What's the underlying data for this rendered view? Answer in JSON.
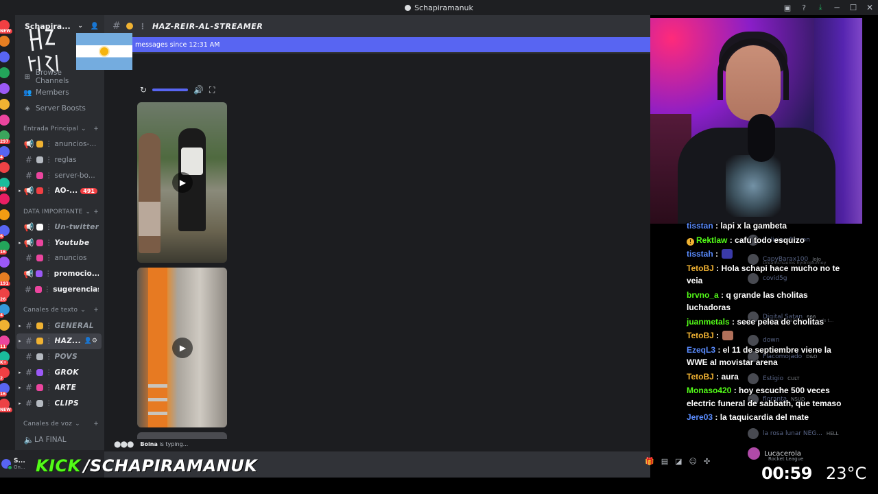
{
  "window": {
    "title": "Schapiramanuk"
  },
  "server": {
    "name": "Schapira..."
  },
  "nav": {
    "browse": "Browse Channels",
    "members": "Members",
    "boosts": "Server Boosts"
  },
  "categories": {
    "entrada": "Entrada Principal",
    "importante": "DATA IMPORTANTE",
    "texto": "Canales de texto",
    "voz": "Canales de voz"
  },
  "channels_entrada": [
    {
      "label": "anuncios-...",
      "emoji_color": "#f0b232"
    },
    {
      "label": "reglas",
      "emoji_color": "#b5bac1"
    },
    {
      "label": "server-bo...",
      "emoji_color": "#eb459e"
    },
    {
      "label": "AO-...",
      "emoji_color": "#f23f43",
      "badge": "491"
    }
  ],
  "channels_importante": [
    {
      "label": "Un-twitter",
      "emoji_color": "#ffffff"
    },
    {
      "label": "Youtube",
      "emoji_color": "#eb459e"
    },
    {
      "label": "anuncios",
      "emoji_color": "#eb459e"
    },
    {
      "label": "promocio...",
      "emoji_color": "#9b59f6"
    },
    {
      "label": "sugerencias",
      "emoji_color": "#eb459e"
    }
  ],
  "channels_texto": [
    {
      "label": "GENERAL",
      "emoji_color": "#f0b232"
    },
    {
      "label": "HAZ...",
      "emoji_color": "#f0b232"
    },
    {
      "label": "POVS",
      "emoji_color": "#b5bac1"
    },
    {
      "label": "GROK",
      "emoji_color": "#9b59f6"
    },
    {
      "label": "ARTE",
      "emoji_color": "#eb459e"
    },
    {
      "label": "CLIPS",
      "emoji_color": "#b5bac1"
    }
  ],
  "channels_voz": [
    {
      "label": "LA FINAL"
    }
  ],
  "rail_badges": [
    "NEW",
    "",
    "",
    "",
    "",
    "",
    "",
    "297",
    "4",
    "",
    "44",
    "",
    "",
    "6",
    "16",
    "",
    "191",
    "26",
    "4",
    "",
    "11",
    "K+",
    "2",
    "16",
    "NEW"
  ],
  "user": {
    "name": "S...",
    "status": "On..."
  },
  "channel": {
    "name": "HAZ-REIR-AL-STREAMER"
  },
  "banner": {
    "text": "messages since 12:31 AM"
  },
  "typing": {
    "user": "Boina",
    "text": " is typing..."
  },
  "kick": {
    "logo": "KICK",
    "handle": "/SCHAPIRAMANUK"
  },
  "chat": [
    {
      "nick": "tisstan",
      "color": "#5a8cff",
      "text": " : lapi x la gambeta"
    },
    {
      "nick": "Rektlaw",
      "color": "#53fc18",
      "text": " : cafu todo esquizo",
      "warn": true
    },
    {
      "nick": "tisstah",
      "color": "#5a8cff",
      "text": " : ",
      "emote": true
    },
    {
      "nick": "TetoBJ",
      "color": "#f0b232",
      "text": " : Hola schapi hace mucho no te veia"
    },
    {
      "nick": "brvno_a",
      "color": "#53fc18",
      "text": " : q grande las cholitas luchadoras"
    },
    {
      "nick": "juanmetals",
      "color": "#53fc18",
      "text": " : seee pelea de cholitas"
    },
    {
      "nick": "TetoBJ",
      "color": "#f0b232",
      "text": " : ",
      "emote": true
    },
    {
      "nick": "EzeqL3",
      "color": "#5a8cff",
      "text": " : el 11 de septiembre viene la WWE al movistar arena"
    },
    {
      "nick": "TetoBJ",
      "color": "#f0b232",
      "text": " : aura"
    },
    {
      "nick": "Monaso420",
      "color": "#53fc18",
      "text": " : hoy escuche 500 veces electric funeral de sabbath, que temaso"
    },
    {
      "nick": "Jere03",
      "color": "#5a8cff",
      "text": " : la taquicardia del mate"
    }
  ],
  "members": [
    {
      "name": "Bolivian Person",
      "tag": ""
    },
    {
      "name": "CapyBarax100",
      "tag": "JoJo",
      "sub": "Dreamchaeros hydrojourney"
    },
    {
      "name": "covid5g",
      "tag": ""
    },
    {
      "name": "Digital Satan",
      "tag": "666",
      "sub": "Constant Shallowness Leads t..."
    },
    {
      "name": "down",
      "tag": ""
    },
    {
      "name": "Flacomojado",
      "tag": "D&D"
    },
    {
      "name": "Estigio",
      "tag": "CULT"
    },
    {
      "name": "floranta",
      "tag": "NSUD"
    },
    {
      "name": "la rosa lunar NEG...",
      "tag": "HELL"
    }
  ],
  "lucacerola": {
    "name": "Lucacerola",
    "sub": "Rocket League"
  },
  "overlay": {
    "timer": "00:59",
    "temperature": "23°C"
  }
}
